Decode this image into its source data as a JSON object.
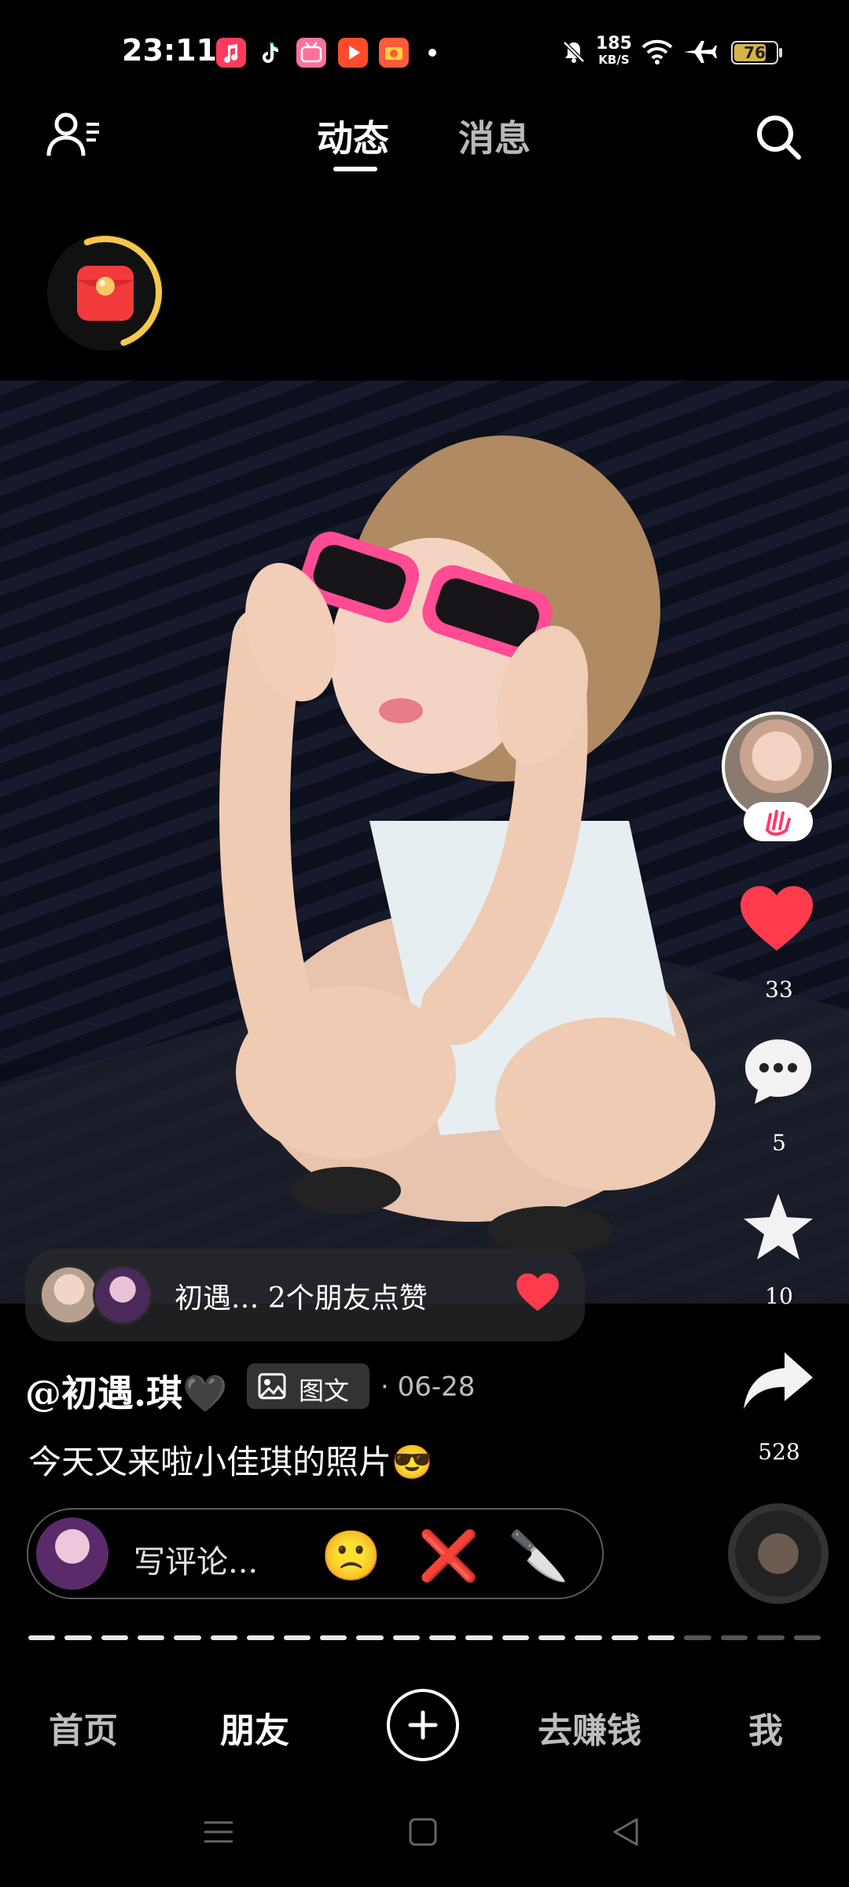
{
  "status_bar": {
    "time": "23:11",
    "net_speed": "185",
    "net_unit": "KB/S",
    "battery": "76",
    "battery_level": 0.76,
    "app_icons": [
      "music-app-icon",
      "tiktok-app-icon",
      "bilibili-app-icon",
      "video-app-icon",
      "camera-app-icon"
    ]
  },
  "top_nav": {
    "tabs": [
      {
        "label": "动态",
        "active": true
      },
      {
        "label": "消息",
        "active": false
      }
    ]
  },
  "post": {
    "liked_by_text": "初遇.‥  2个朋友点赞",
    "username": "@初遇.琪🖤",
    "type_label": "图文",
    "date": "06-28",
    "caption": "今天又来啦小佳琪的照片😎"
  },
  "actions": {
    "likes": "33",
    "comments": "5",
    "favorites": "10",
    "shares": "528"
  },
  "comment_bar": {
    "placeholder": "写评论...",
    "quick_emojis": [
      "🙁",
      "❌",
      "🔪"
    ]
  },
  "progress": {
    "total": 22,
    "viewed": 18
  },
  "bottom_nav": {
    "items": [
      {
        "label": "首页",
        "active": false
      },
      {
        "label": "朋友",
        "active": true
      },
      {
        "label": "去赚钱",
        "active": false
      },
      {
        "label": "我",
        "active": false
      }
    ]
  },
  "colors": {
    "accent_red": "#ff3b4e",
    "packet_ring": "#f5c84b",
    "background": "#000000"
  }
}
